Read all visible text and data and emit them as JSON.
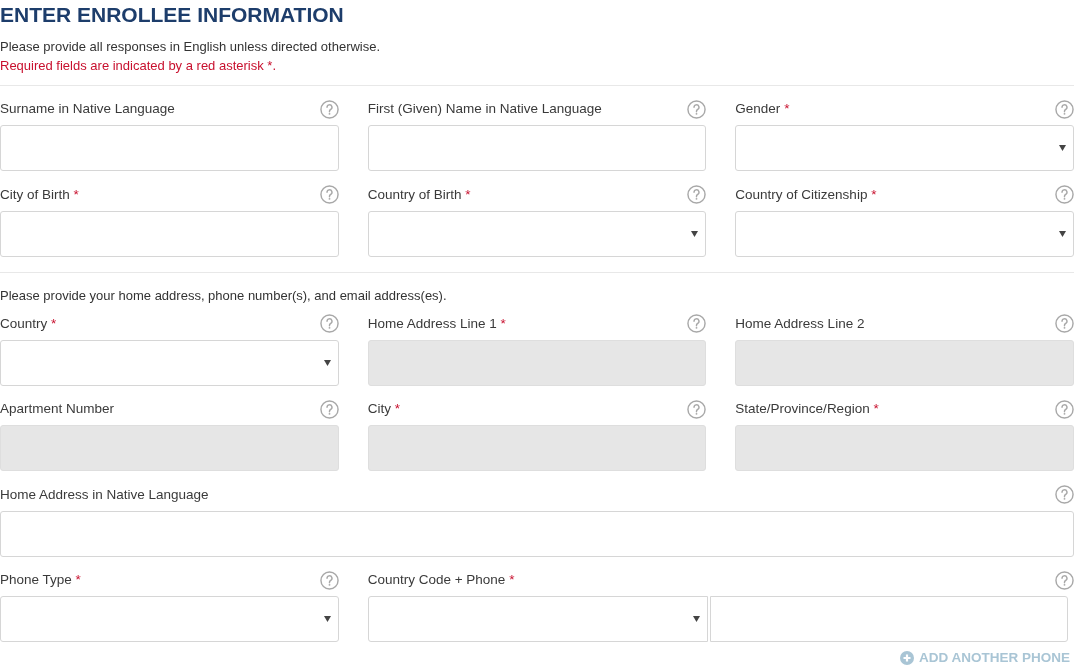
{
  "heading": "ENTER ENROLLEE INFORMATION",
  "instructions": "Please provide all responses in English unless directed otherwise.",
  "required_note": "Required fields are indicated by a red asterisk *.",
  "sections": [
    {
      "rows": [
        [
          {
            "label": "Surname in Native Language",
            "kind": "text",
            "disabled": false
          },
          {
            "label": "First (Given) Name in Native Language",
            "kind": "text",
            "disabled": false
          },
          {
            "label": "Gender",
            "asterisk": "*",
            "kind": "select",
            "disabled": false
          }
        ],
        [
          {
            "label": "City of Birth",
            "asterisk": "*",
            "kind": "text",
            "disabled": false
          },
          {
            "label": "Country of Birth",
            "asterisk": "*",
            "kind": "select",
            "disabled": false
          },
          {
            "label": "Country of Citizenship",
            "asterisk": "*",
            "kind": "select",
            "disabled": false
          }
        ]
      ]
    },
    {
      "intro": "Please provide your home address, phone number(s), and email address(es).",
      "rows": [
        [
          {
            "label": "Country",
            "asterisk": "*",
            "kind": "select",
            "disabled": false
          },
          {
            "label": "Home Address Line 1",
            "asterisk": "*",
            "kind": "text",
            "disabled": true
          },
          {
            "label": "Home Address Line 2",
            "kind": "text",
            "disabled": true
          }
        ],
        [
          {
            "label": "Apartment Number",
            "kind": "text",
            "disabled": true
          },
          {
            "label": "City",
            "asterisk": "*",
            "kind": "text",
            "disabled": true
          },
          {
            "label": "State/Province/Region",
            "asterisk": "*",
            "kind": "text",
            "disabled": true
          }
        ],
        [
          {
            "label": "Home Address in Native Language",
            "kind": "text",
            "disabled": false
          }
        ],
        [
          {
            "label": "Phone Type",
            "asterisk": "*",
            "kind": "select",
            "disabled": false
          },
          {
            "label": "Country Code + Phone",
            "asterisk": "*",
            "kind": "phone",
            "disabled": false
          }
        ]
      ]
    }
  ],
  "add_phone_link": "ADD ANOTHER PHONE"
}
